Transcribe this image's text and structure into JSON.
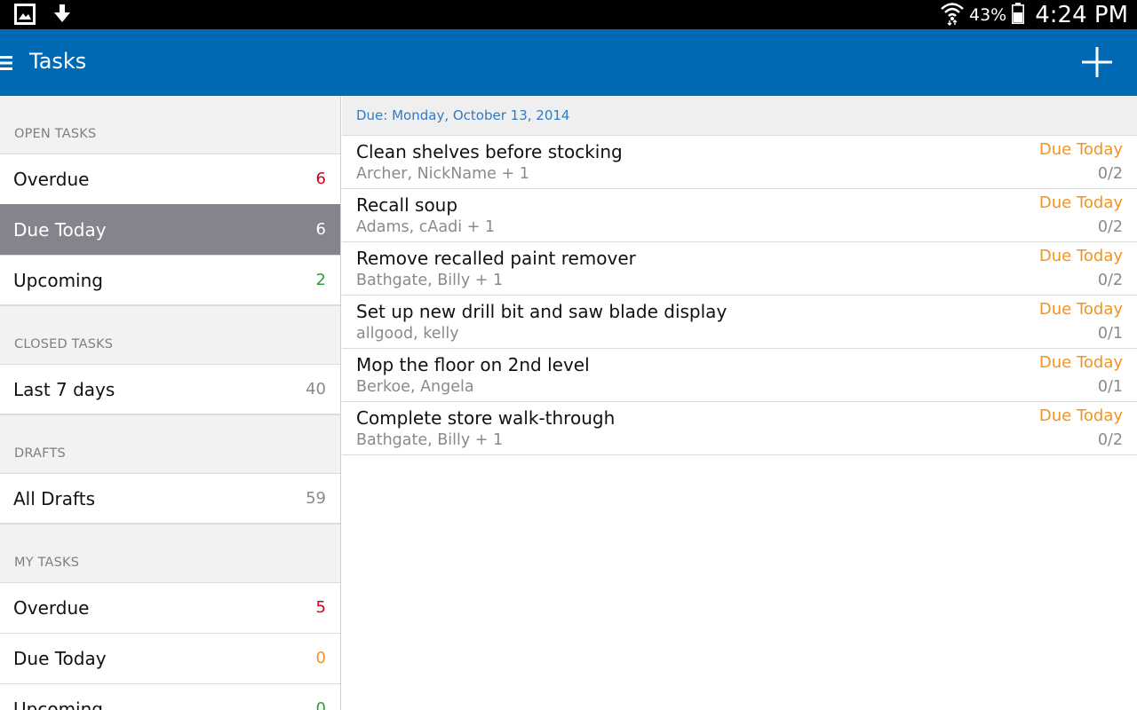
{
  "status_bar": {
    "icons": [
      "gallery-icon",
      "download-icon",
      "wifi-icon",
      "battery-icon"
    ],
    "battery_percent": "43%",
    "time": "4:24 PM"
  },
  "appbar": {
    "title": "Tasks",
    "icons": [
      "menu-icon",
      "add-icon"
    ]
  },
  "sidebar": {
    "open_tasks": {
      "header": "OPEN TASKS",
      "items": [
        {
          "label": "Overdue",
          "count": "6",
          "count_color": "#d0021b"
        },
        {
          "label": "Due Today",
          "count": "6",
          "count_color": "#ffffff"
        },
        {
          "label": "Upcoming",
          "count": "2",
          "count_color": "#2e9e3e"
        }
      ]
    },
    "closed_tasks": {
      "header": "CLOSED TASKS",
      "items": [
        {
          "label": "Last 7 days",
          "count": "40",
          "count_color": "#8a8a8a"
        }
      ]
    },
    "drafts": {
      "header": "DRAFTS",
      "items": [
        {
          "label": "All Drafts",
          "count": "59",
          "count_color": "#8a8a8a"
        }
      ]
    },
    "my_tasks": {
      "header": "MY TASKS",
      "items": [
        {
          "label": "Overdue",
          "count": "5",
          "count_color": "#d0021b"
        },
        {
          "label": "Due Today",
          "count": "0",
          "count_color": "#f39321"
        },
        {
          "label": "Upcoming",
          "count": "0",
          "count_color": "#2e9e3e"
        }
      ]
    }
  },
  "main": {
    "due_header": "Due: Monday, October 13, 2014",
    "tasks": [
      {
        "title": "Clean shelves before stocking",
        "assignees": "Archer, NickName + 1",
        "status": "Due Today",
        "progress": "0/2"
      },
      {
        "title": "Recall soup",
        "assignees": "Adams, cAadi + 1",
        "status": "Due Today",
        "progress": "0/2"
      },
      {
        "title": "Remove recalled paint remover",
        "assignees": "Bathgate, Billy + 1",
        "status": "Due Today",
        "progress": "0/2"
      },
      {
        "title": "Set up new drill bit and saw blade display",
        "assignees": "allgood, kelly",
        "status": "Due Today",
        "progress": "0/1"
      },
      {
        "title": "Mop the floor on 2nd level",
        "assignees": "Berkoe, Angela",
        "status": "Due Today",
        "progress": "0/1"
      },
      {
        "title": "Complete store walk-through",
        "assignees": "Bathgate, Billy + 1",
        "status": "Due Today",
        "progress": "0/2"
      }
    ]
  },
  "colors": {
    "appbar": "#0069b3",
    "selected_item": "#84848d",
    "due_status": "#f39321",
    "date_header": "#2f7bc4"
  }
}
